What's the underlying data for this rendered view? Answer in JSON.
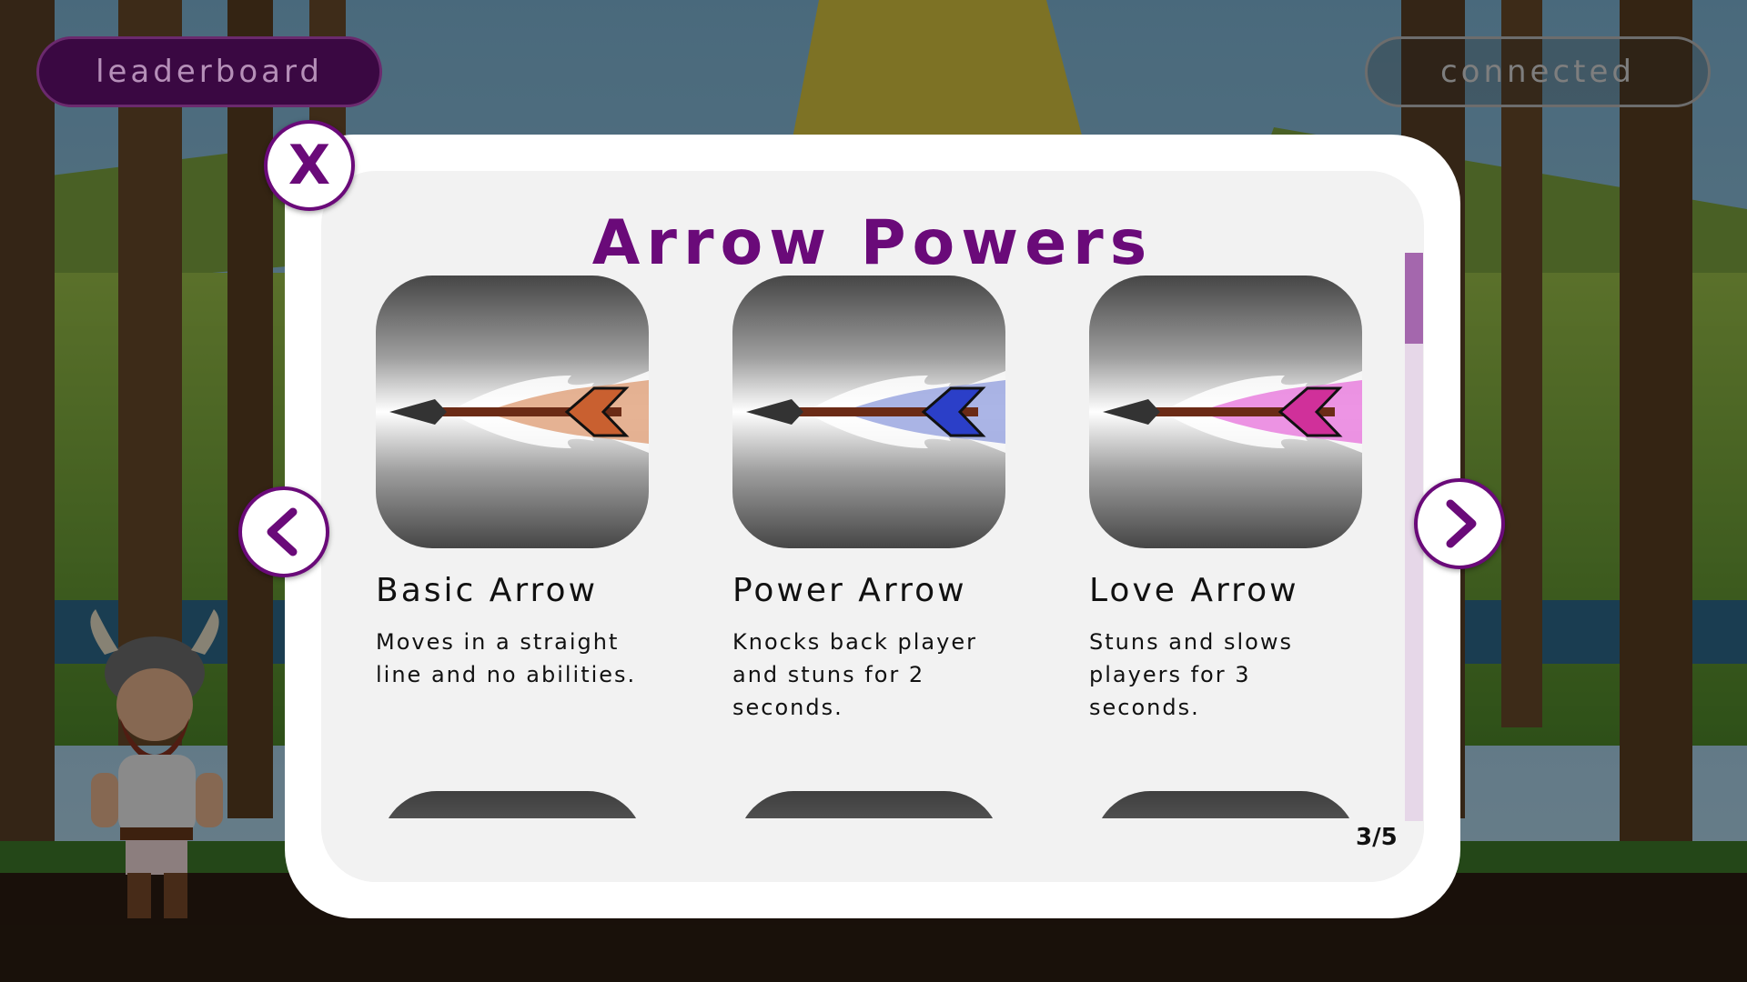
{
  "top_bar": {
    "leaderboard_label": "leaderboard",
    "status_label": "connected"
  },
  "modal": {
    "title": "Arrow Powers",
    "close_label": "X",
    "page_counter": "3/5",
    "scroll_position_fraction": 0.0,
    "items": [
      {
        "name": "Basic Arrow",
        "desc_lines": [
          "Moves in a straight",
          "line and no abilities."
        ],
        "flame_color": "#d98a5a",
        "fletching_color": "#c96030"
      },
      {
        "name": "Power Arrow",
        "desc_lines": [
          "Knocks back player",
          "and stuns for 2",
          "seconds."
        ],
        "flame_color": "#7e8ed8",
        "fletching_color": "#2b3fc8"
      },
      {
        "name": "Love Arrow",
        "desc_lines": [
          "Stuns and slows",
          "players for 3",
          "seconds."
        ],
        "flame_color": "#e45ad6",
        "fletching_color": "#d0309a"
      }
    ]
  },
  "colors": {
    "accent_purple": "#6a0a79",
    "modal_bg": "#ffffff",
    "panel_bg": "#f2f2f2"
  },
  "icons": {
    "close": "close-icon",
    "prev": "chevron-left-icon",
    "next": "chevron-right-icon"
  }
}
